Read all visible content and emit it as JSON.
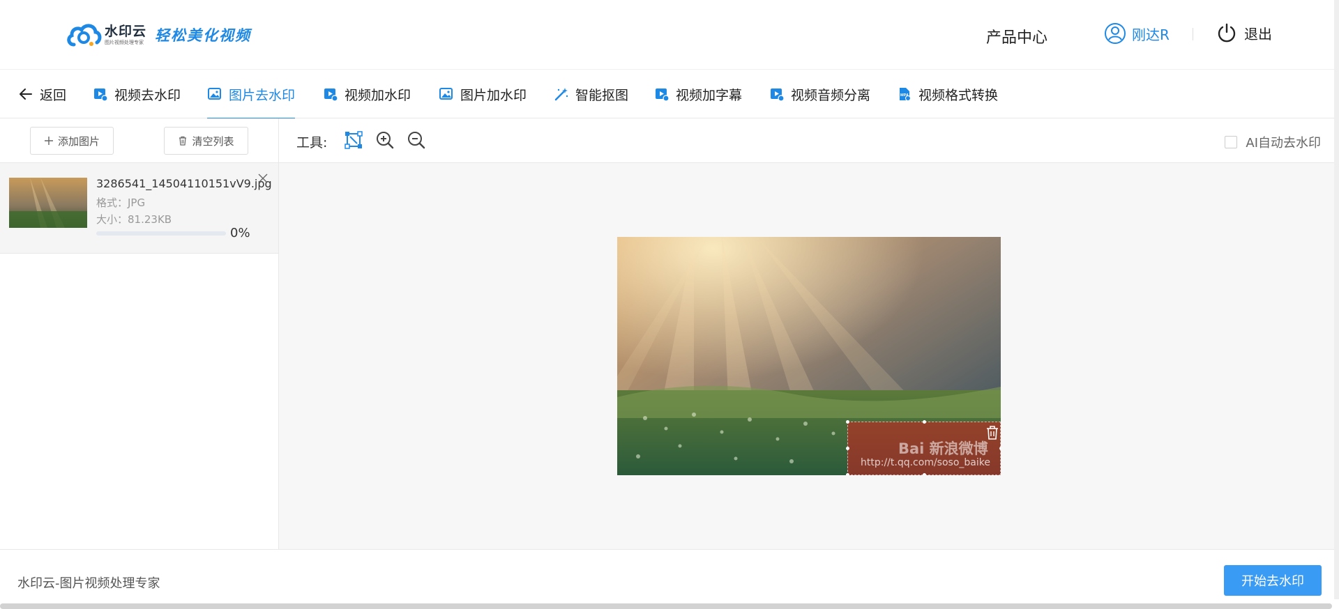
{
  "header": {
    "logo_name": "水印云",
    "logo_sub": "图片视频处理专家",
    "slogan": "轻松美化视频",
    "product_center": "产品中心",
    "user_name": "刚达R",
    "logout": "退出"
  },
  "tabs": {
    "back": "返回",
    "items": [
      {
        "label": "视频去水印",
        "icon": "video-icon"
      },
      {
        "label": "图片去水印",
        "icon": "image-icon",
        "active": true
      },
      {
        "label": "视频加水印",
        "icon": "video-icon"
      },
      {
        "label": "图片加水印",
        "icon": "image-icon"
      },
      {
        "label": "智能抠图",
        "icon": "magic-wand-icon"
      },
      {
        "label": "视频加字幕",
        "icon": "video-icon"
      },
      {
        "label": "视频音频分离",
        "icon": "video-icon"
      },
      {
        "label": "视频格式转换",
        "icon": "mp4-file-icon"
      }
    ]
  },
  "file_panel": {
    "add_image": "添加图片",
    "clear_list": "清空列表",
    "files": [
      {
        "name": "3286541_14504110151vV9.jpg",
        "format": "格式：JPG",
        "size": "大小：81.23KB",
        "progress_text": "0%",
        "progress": 0
      }
    ]
  },
  "workspace": {
    "tools_label": "工具:",
    "ai_auto": "AI自动去水印",
    "watermark_text_1": "Bai 新浪微博",
    "watermark_text_2": "http://t.qq.com/soso_baike"
  },
  "footer": {
    "brand_text": "水印云-图片视频处理专家",
    "start_button": "开始去水印"
  },
  "colors": {
    "accent": "#1e88e5",
    "button": "#3a9bf5",
    "watermark_box": "#d21e1e"
  }
}
